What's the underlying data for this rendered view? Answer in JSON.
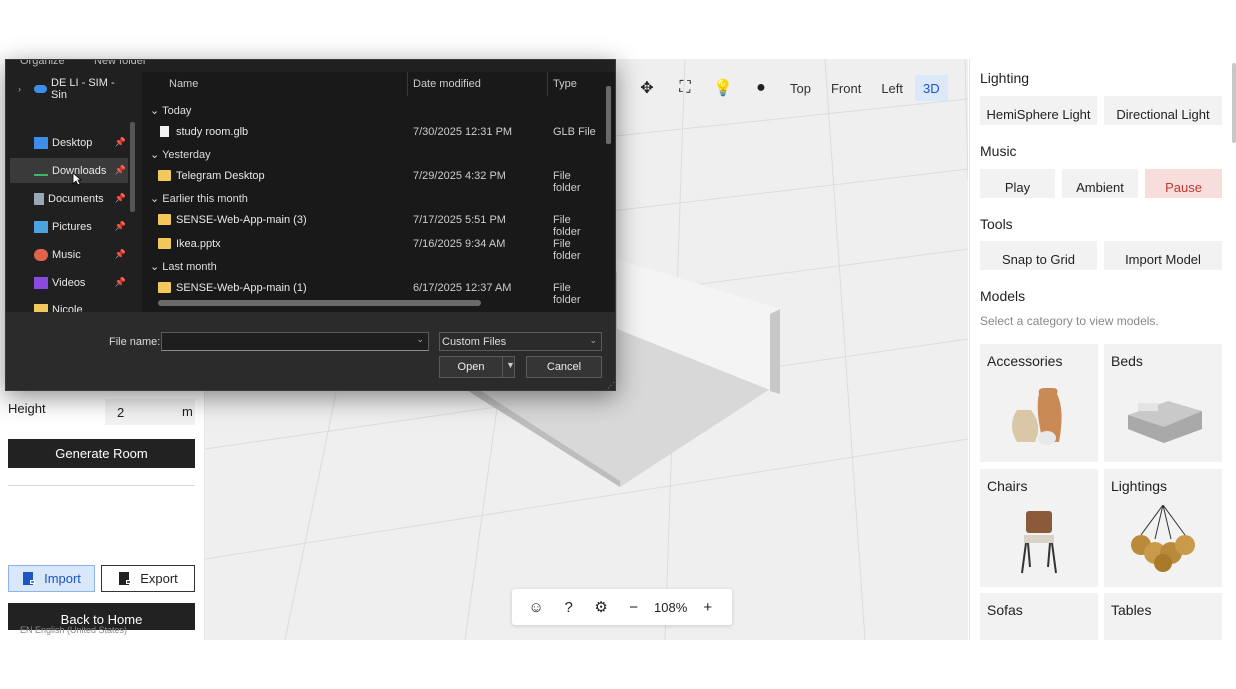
{
  "dialog": {
    "top_left_label": "Organize",
    "top_new_folder": "New folder",
    "nav_items": [
      {
        "label": "DE LI - SIM - Sin",
        "icon": "cloud-icon"
      },
      {
        "label": "Desktop",
        "icon": "desktop-icon"
      },
      {
        "label": "Downloads",
        "icon": "download-icon"
      },
      {
        "label": "Documents",
        "icon": "documents-icon"
      },
      {
        "label": "Pictures",
        "icon": "pictures-icon"
      },
      {
        "label": "Music",
        "icon": "music-icon"
      },
      {
        "label": "Videos",
        "icon": "videos-icon"
      },
      {
        "label": "Nicole",
        "icon": "folder-icon"
      }
    ],
    "columns": {
      "name": "Name",
      "date": "Date modified",
      "type": "Type"
    },
    "groups": {
      "today": "Today",
      "yesterday": "Yesterday",
      "earlier": "Earlier this month",
      "last_month": "Last month"
    },
    "rows": [
      {
        "name": "study room.glb",
        "date": "7/30/2025 12:31 PM",
        "type": "GLB File"
      },
      {
        "name": "Telegram Desktop",
        "date": "7/29/2025 4:32 PM",
        "type": "File folder"
      },
      {
        "name": "SENSE-Web-App-main (3)",
        "date": "7/17/2025 5:51 PM",
        "type": "File folder"
      },
      {
        "name": "Ikea.pptx",
        "date": "7/16/2025 9:34 AM",
        "type": "File folder"
      },
      {
        "name": "SENSE-Web-App-main (1)",
        "date": "6/17/2025 12:37 AM",
        "type": "File folder"
      }
    ],
    "file_name_label": "File name:",
    "file_name_value": "",
    "file_type": "Custom Files",
    "open_label": "Open",
    "cancel_label": "Cancel"
  },
  "left": {
    "height_label": "Height",
    "height_value": "2",
    "height_unit": "m",
    "generate_label": "Generate Room",
    "import_label": "Import",
    "export_label": "Export",
    "home_label": "Back to Home",
    "lang_hint": "EN English (United States)"
  },
  "viewport": {
    "views": [
      "Top",
      "Front",
      "Left",
      "3D"
    ],
    "active_view": "3D",
    "zoom": "108%"
  },
  "right": {
    "lighting_title": "Lighting",
    "hemi_label": "HemiSphere Light",
    "directional_label": "Directional Light",
    "music_title": "Music",
    "play_label": "Play",
    "ambient_label": "Ambient",
    "pause_label": "Pause",
    "tools_title": "Tools",
    "snap_label": "Snap to Grid",
    "import_model_label": "Import Model",
    "models_title": "Models",
    "models_subtitle": "Select a category to view models.",
    "categories": [
      "Accessories",
      "Beds",
      "Chairs",
      "Lightings",
      "Sofas",
      "Tables"
    ]
  },
  "colors": {
    "accent": "#1a56c4",
    "pause_bg": "#f7dedd",
    "dialog_bg": "#202020"
  }
}
